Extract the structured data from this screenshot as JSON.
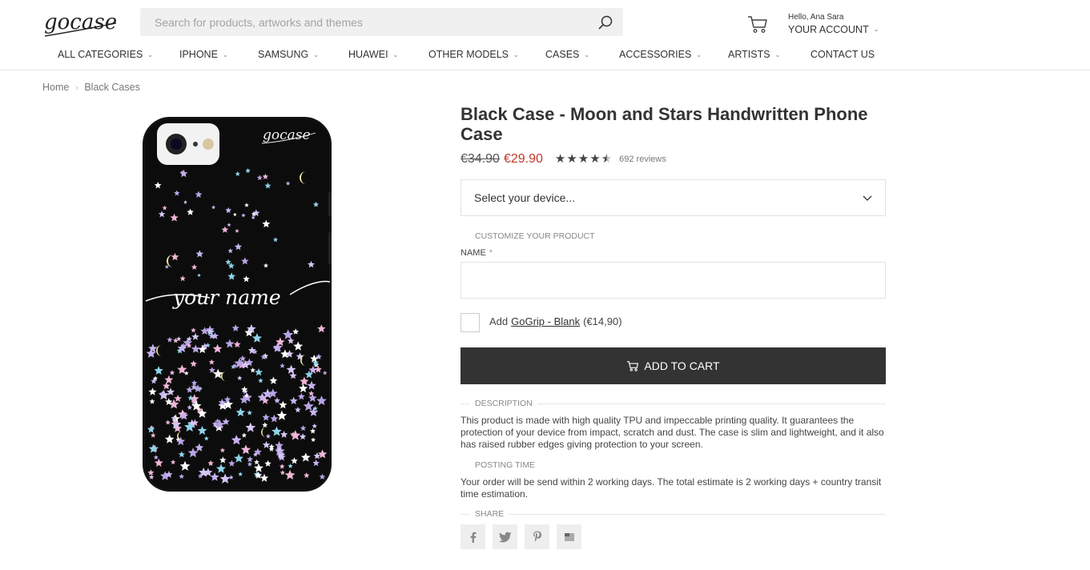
{
  "header": {
    "logo_text": "gocase",
    "search_placeholder": "Search for products, artworks and themes",
    "account_greeting": "Hello, Ana Sara",
    "account_label": "YOUR ACCOUNT"
  },
  "nav": {
    "items": [
      {
        "label": "ALL CATEGORIES"
      },
      {
        "label": "IPHONE"
      },
      {
        "label": "SAMSUNG"
      },
      {
        "label": "HUAWEI"
      },
      {
        "label": "OTHER MODELS"
      },
      {
        "label": "CASES"
      },
      {
        "label": "ACCESSORIES"
      },
      {
        "label": "ARTISTS"
      },
      {
        "label": "CONTACT US"
      }
    ]
  },
  "breadcrumb": {
    "items": [
      "Home",
      "Black Cases"
    ]
  },
  "product": {
    "title": "Black Case - Moon and Stars Handwritten Phone Case",
    "old_price": "€34.90",
    "price": "€29.90",
    "rating": 4.5,
    "reviews": "692 reviews",
    "device_select": "Select your device...",
    "customize_label": "CUSTOMIZE YOUR PRODUCT",
    "name_label": "NAME",
    "required_mark": "*",
    "gogrip_prefix": "Add",
    "gogrip_link": "GoGrip - Blank",
    "gogrip_price": "(€14,90)",
    "add_to_cart": "ADD TO CART",
    "image_text": "your name",
    "case_logo": "gocase"
  },
  "sections": {
    "description_label": "DESCRIPTION",
    "description_text": "This product is made with high quality TPU and impeccable printing quality. It guarantees the protection of your device from impact, scratch and dust. The case is slim and lightweight, and it also has raised rubber edges giving protection to your screen.",
    "posting_label": "POSTING TIME",
    "posting_text": "Your order will be send within 2 working days. The total estimate is 2 working days + country transit time estimation.",
    "share_label": "SHARE"
  },
  "share": {
    "buttons": [
      "facebook-icon",
      "twitter-icon",
      "pinterest-icon",
      "email-icon"
    ]
  }
}
